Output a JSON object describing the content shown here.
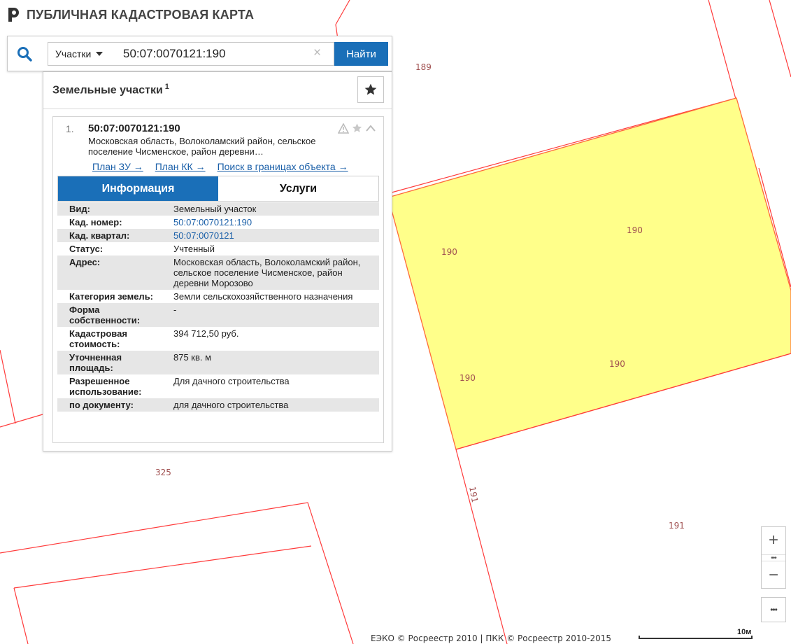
{
  "app": {
    "title": "ПУБЛИЧНАЯ КАДАСТРОВАЯ КАРТА"
  },
  "search": {
    "type_label": "Участки",
    "value": "50:07:0070121:190",
    "clear_symbol": "×",
    "button_label": "Найти"
  },
  "panel": {
    "title": "Земельные участки",
    "count": "1"
  },
  "result": {
    "index": "1.",
    "cad_number": "50:07:0070121:190",
    "address_short": "Московская область, Волоколамский район, сельское поселение Чисменское, район деревни…",
    "links": [
      "План ЗУ →",
      "План КК →",
      "Поиск в границах объекта →"
    ],
    "tabs": {
      "info": "Информация",
      "services": "Услуги"
    },
    "fields": [
      {
        "key": "Вид:",
        "value": "Земельный участок",
        "link": false
      },
      {
        "key": "Кад. номер:",
        "value": "50:07:0070121:190",
        "link": true
      },
      {
        "key": "Кад. квартал:",
        "value": "50:07:0070121",
        "link": true
      },
      {
        "key": "Статус:",
        "value": "Учтенный",
        "link": false
      },
      {
        "key": "Адрес:",
        "value": "Московская область, Волоколамский район, сельское поселение Чисменское, район деревни Морозово",
        "link": false
      },
      {
        "key": "Категория земель:",
        "value": "Земли сельскохозяйственного назначения",
        "link": false
      },
      {
        "key": "Форма собственности:",
        "value": "-",
        "link": false
      },
      {
        "key": "Кадастровая стоимость:",
        "value": "394 712,50 руб.",
        "link": false
      },
      {
        "key": "Уточненная площадь:",
        "value": "875 кв. м",
        "link": false
      },
      {
        "key": "Разрешенное использование:",
        "value": "Для дачного строительства",
        "link": false
      },
      {
        "key": "по документу:",
        "value": "для дачного строительства",
        "link": false
      }
    ]
  },
  "map": {
    "labels": {
      "p189": "189",
      "p190_a": "190",
      "p190_b": "190",
      "p190_c": "190",
      "p190_d": "190",
      "p191_a": "191",
      "p191_b": "191",
      "p325": "325"
    },
    "colors": {
      "boundary": "#ff3b3b",
      "selected_fill": "#ffff8a",
      "selected_stroke": "#ff6a3a"
    }
  },
  "controls": {
    "zoom_in": "+",
    "zoom_mid": "•••",
    "zoom_out": "−",
    "more": "•••"
  },
  "footer": {
    "copyright": "ЕЭКО © Росреестр 2010 | ПКК © Росреестр 2010-2015",
    "scale": "10м"
  },
  "icons": {
    "logo": "pkk-logo-icon",
    "search": "magnifier-icon",
    "favorite": "star-icon",
    "warning": "warning-triangle-icon",
    "collapse": "chevron-up-icon"
  }
}
